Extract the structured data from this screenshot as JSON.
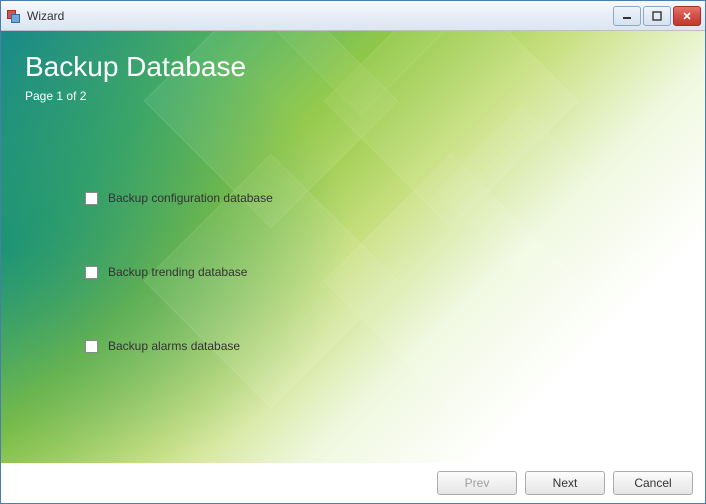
{
  "window": {
    "title": "Wizard"
  },
  "header": {
    "title": "Backup Database",
    "subtitle": "Page 1 of 2"
  },
  "options": [
    {
      "label": "Backup configuration database",
      "checked": false
    },
    {
      "label": "Backup trending database",
      "checked": false
    },
    {
      "label": "Backup alarms database",
      "checked": false
    }
  ],
  "buttons": {
    "prev": "Prev",
    "next": "Next",
    "cancel": "Cancel"
  }
}
